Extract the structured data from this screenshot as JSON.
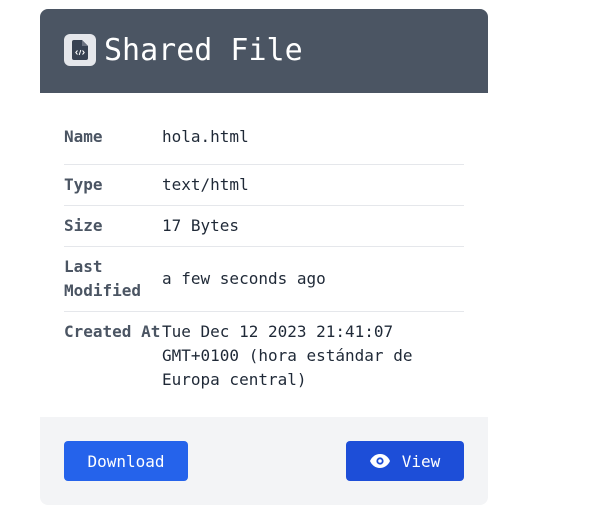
{
  "header": {
    "icon": "file-code-icon",
    "title": "Shared File"
  },
  "details": {
    "rows": [
      {
        "label": "Name",
        "value": "hola.html"
      },
      {
        "label": "Type",
        "value": "text/html"
      },
      {
        "label": "Size",
        "value": "17 Bytes"
      },
      {
        "label": "Last Modified",
        "value": "a few seconds ago"
      },
      {
        "label": "Created At",
        "value": "Tue Dec 12 2023 21:41:07 GMT+0100 (hora estándar de Europa central)"
      }
    ]
  },
  "actions": {
    "download_label": "Download",
    "view_label": "View",
    "view_icon": "eye-icon"
  },
  "colors": {
    "header_bg": "#4b5563",
    "download_bg": "#2563eb",
    "view_bg": "#1d4ed8",
    "footer_bg": "#f3f4f6"
  }
}
